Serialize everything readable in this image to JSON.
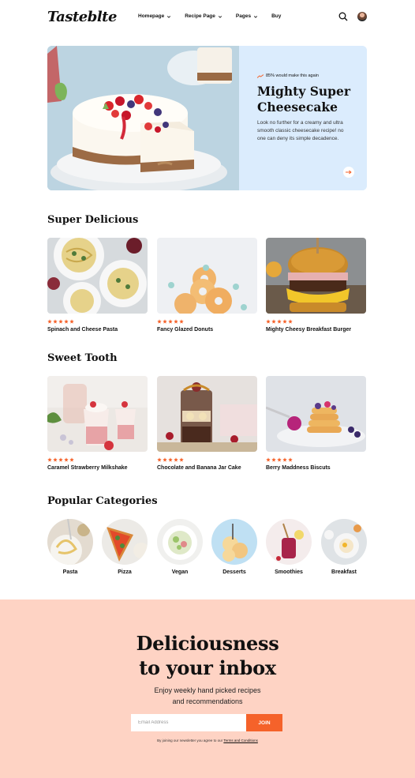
{
  "header": {
    "logo": "Tasteblte",
    "nav": [
      {
        "label": "Homepage",
        "dropdown": true
      },
      {
        "label": "Recipe Page",
        "dropdown": true
      },
      {
        "label": "Pages",
        "dropdown": true
      },
      {
        "label": "Buy",
        "dropdown": false
      }
    ]
  },
  "hero": {
    "trend_text": "85% would make this again",
    "title": "Mighty Super Cheesecake",
    "description": "Look no further for a creamy and ultra smooth classic cheesecake recipe! no one can deny its simple decadence."
  },
  "super_delicious": {
    "title": "Super Delicious",
    "cards": [
      {
        "title": "Spinach and Cheese Pasta",
        "rating": 5
      },
      {
        "title": "Fancy Glazed Donuts",
        "rating": 5
      },
      {
        "title": "Mighty Cheesy Breakfast Burger",
        "rating": 5
      }
    ]
  },
  "sweet_tooth": {
    "title": "Sweet Tooth",
    "cards": [
      {
        "title": "Caramel Strawberry Milkshake",
        "rating": 5
      },
      {
        "title": "Chocolate and Banana Jar Cake",
        "rating": 5
      },
      {
        "title": "Berry Maddness Biscuts",
        "rating": 5
      }
    ]
  },
  "categories": {
    "title": "Popular Categories",
    "items": [
      {
        "label": "Pasta"
      },
      {
        "label": "Pizza"
      },
      {
        "label": "Vegan"
      },
      {
        "label": "Desserts"
      },
      {
        "label": "Smoothies"
      },
      {
        "label": "Breakfast"
      }
    ]
  },
  "newsletter": {
    "title_line1": "Deliciousness",
    "title_line2": "to your inbox",
    "subtitle_line1": "Enjoy weekly hand picked recipes",
    "subtitle_line2": "and recommendations",
    "email_placeholder": "Email Address",
    "button_label": "JOIN",
    "fine_print": "By joining our newsletter you agree to our",
    "terms_link": "Terms and Conditions"
  },
  "colors": {
    "accent": "#f5622a",
    "hero_panel": "#dbecfd",
    "newsletter_bg": "#fed3c4"
  }
}
